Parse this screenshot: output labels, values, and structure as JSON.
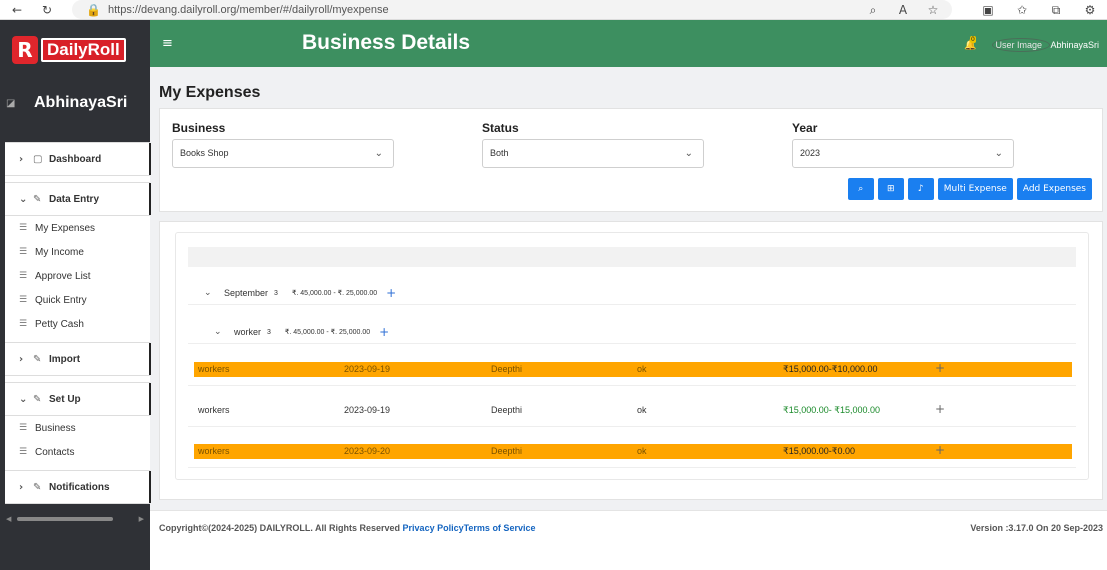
{
  "browser": {
    "url": "https://devang.dailyroll.org/member/#/dailyroll/myexpense"
  },
  "sidebar": {
    "logo_r": "R",
    "logo_daily": "Daily",
    "logo_roll": "Roll",
    "user_name": "AbhinayaSri",
    "sections": [
      {
        "label": "Dashboard"
      },
      {
        "label": "Data Entry"
      },
      {
        "label": "Import"
      },
      {
        "label": "Set Up"
      },
      {
        "label": "Notifications"
      }
    ],
    "data_entry_items": [
      "My Expenses",
      "My Income",
      "Approve List",
      "Quick Entry",
      "Petty Cash"
    ],
    "setup_items": [
      "Business",
      "Contacts"
    ]
  },
  "header": {
    "title": "Business Details",
    "bell_badge": "0",
    "user_image_alt": "User Image",
    "user_name": "AbhinayaSri"
  },
  "page": {
    "title": "My Expenses"
  },
  "filters": {
    "business_label": "Business",
    "business_value": "Books Shop",
    "status_label": "Status",
    "status_value": "Both",
    "year_label": "Year",
    "year_value": "2023",
    "multi_expense": "Multi Expense",
    "add_expenses": "Add Expenses"
  },
  "groups": {
    "month": {
      "label": "September",
      "count": "3",
      "amount": "₹. 45,000.00 - ₹. 25,000.00"
    },
    "category": {
      "label": "worker",
      "count": "3",
      "amount": "₹. 45,000.00 - ₹. 25,000.00"
    }
  },
  "rows": [
    {
      "name": "workers",
      "date": "2023-09-19",
      "person": "Deepthi",
      "status": "ok",
      "amount": "₹15,000.00-₹10,000.00",
      "highlight": true
    },
    {
      "name": "workers",
      "date": "2023-09-19",
      "person": "Deepthi",
      "status": "ok",
      "amount": "₹15,000.00- ₹15,000.00",
      "highlight": false
    },
    {
      "name": "workers",
      "date": "2023-09-20",
      "person": "Deepthi",
      "status": "ok",
      "amount": "₹15,000.00-₹0.00",
      "highlight": true
    }
  ],
  "footer": {
    "copyright": "Copyright©(2024-2025) DAILYROLL. All Rights Reserved",
    "privacy": "Privacy Policy",
    "terms": "Terms of Service",
    "version": "Version :3.17.0 On 20 Sep-2023"
  },
  "colors": {
    "header": "#3d8f60",
    "sidebar": "#2f3136",
    "highlight_row": "#ffa500",
    "button": "#1a7ff0"
  }
}
